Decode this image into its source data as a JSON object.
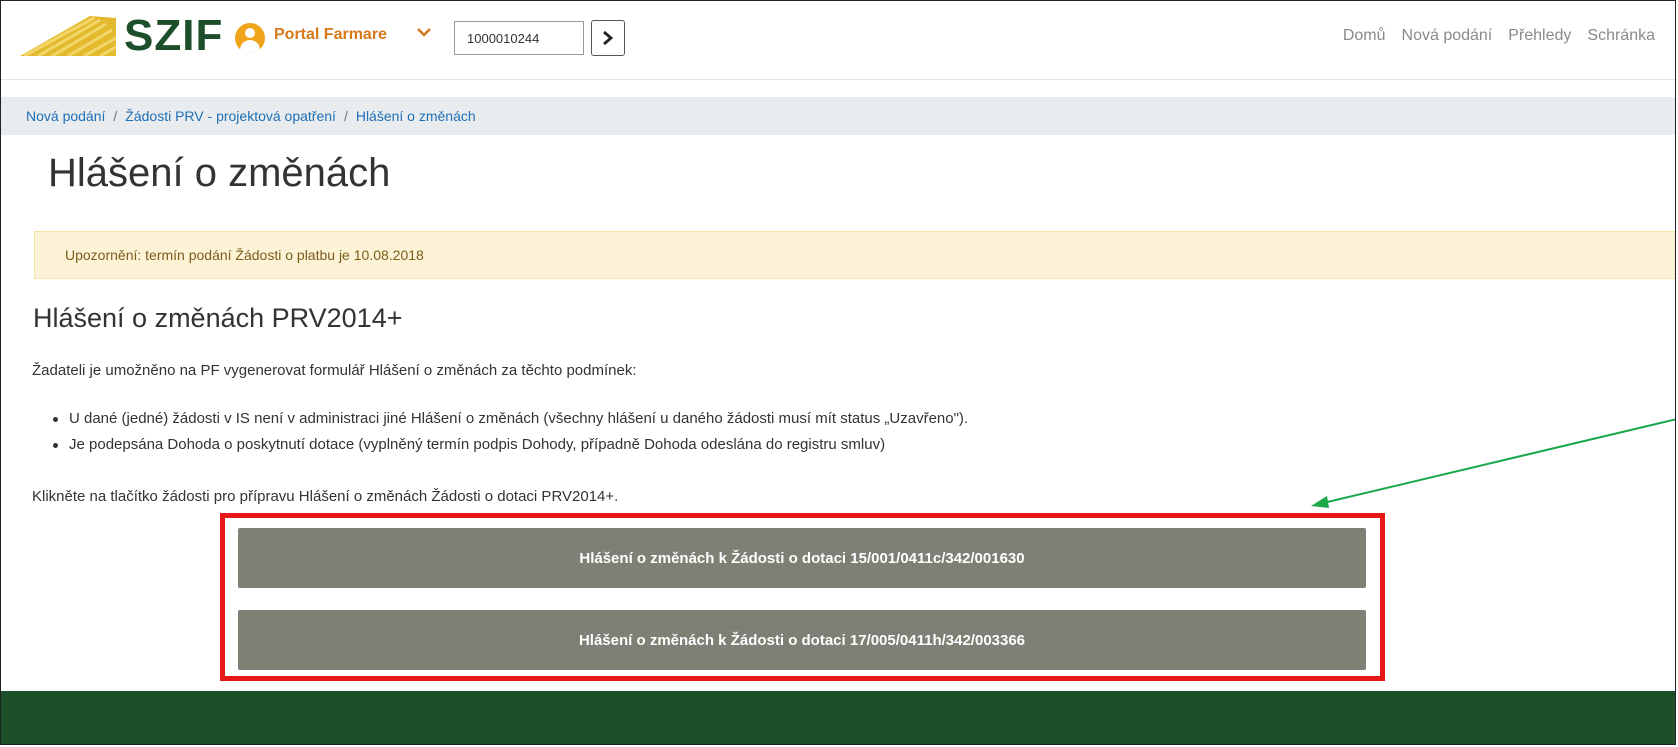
{
  "header": {
    "logo_text": "SZIF",
    "portal_label": "Portal Farmare",
    "client_id": "1000010244",
    "nav": [
      "Domů",
      "Nová podání",
      "Přehledy",
      "Schránka"
    ]
  },
  "breadcrumb": [
    "Nová podání",
    "Žádosti PRV - projektová opatření",
    "Hlášení o změnách"
  ],
  "page_title": "Hlášení o změnách",
  "alert": "Upozornění: termín podání Žádosti o platbu je 10.08.2018",
  "section_title": "Hlášení o změnách PRV2014+",
  "intro": "Žadateli je umožněno na PF vygenerovat formulář Hlášení o změnách za těchto podmínek:",
  "conditions": [
    "U dané (jedné) žádosti v IS není v administraci jiné Hlášení o změnách (všechny hlášení u daného žádosti musí mít status „Uzavřeno\").",
    "Je podepsána Dohoda o poskytnutí dotace (vyplněný termín podpis Dohody, případně Dohoda odeslána do registru smluv)"
  ],
  "instruction": "Klikněte na tlačítko žádosti pro přípravu Hlášení o změnách Žádosti o dotaci PRV2014+.",
  "buttons": [
    "Hlášení o změnách k Žádosti o dotaci 15/001/0411c/342/001630",
    "Hlášení o změnách k Žádosti o dotaci 17/005/0411h/342/003366"
  ],
  "colors": {
    "brand_green": "#1d4f2a",
    "portal_orange": "#d6791b",
    "button_grey": "#7f7f76",
    "highlight_red": "#e51717",
    "arrow_green": "#1aa84a"
  }
}
